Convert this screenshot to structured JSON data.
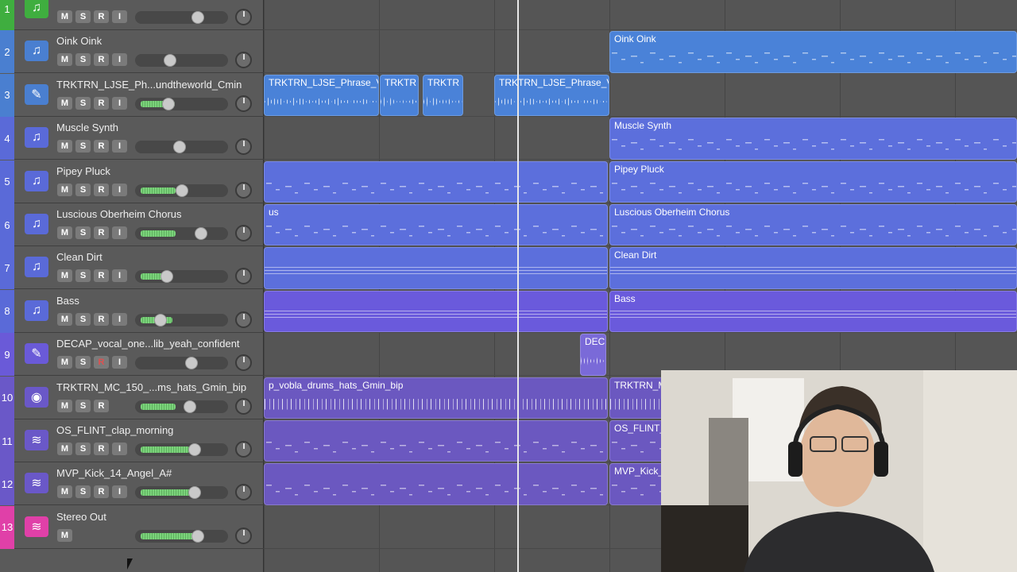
{
  "tracks": [
    {
      "num": "1",
      "name": "",
      "color": "#3fae3f",
      "icon": "note-icon",
      "buttons": [
        "M",
        "S",
        "R",
        "I"
      ],
      "level": 0,
      "knob": 0.7
    },
    {
      "num": "2",
      "name": "Oink Oink",
      "color": "#4a7fd0",
      "icon": "note-icon",
      "buttons": [
        "M",
        "S",
        "R",
        "I"
      ],
      "level": 0,
      "knob": 0.36
    },
    {
      "num": "3",
      "name": "TRKTRN_LJSE_Ph...undtheworld_Cmin",
      "color": "#4a7fd0",
      "icon": "pencil-icon",
      "buttons": [
        "M",
        "S",
        "R",
        "I"
      ],
      "level": 0.43,
      "knob": 0.34
    },
    {
      "num": "4",
      "name": "Muscle Synth",
      "color": "#5a6ad8",
      "icon": "note-icon",
      "buttons": [
        "M",
        "S",
        "R",
        "I"
      ],
      "level": 0,
      "knob": 0.48
    },
    {
      "num": "5",
      "name": "Pipey Pluck",
      "color": "#5a6ad8",
      "icon": "note-icon",
      "buttons": [
        "M",
        "S",
        "R",
        "I"
      ],
      "level": 0.44,
      "knob": 0.5
    },
    {
      "num": "6",
      "name": "Luscious Oberheim Chorus",
      "color": "#5a6ad8",
      "icon": "note-icon",
      "buttons": [
        "M",
        "S",
        "R",
        "I"
      ],
      "level": 0.44,
      "knob": 0.74
    },
    {
      "num": "7",
      "name": "Clean Dirt",
      "color": "#5a6ad8",
      "icon": "note-icon",
      "buttons": [
        "M",
        "S",
        "R",
        "I"
      ],
      "level": 0.32,
      "knob": 0.32
    },
    {
      "num": "8",
      "name": "Bass",
      "color": "#5a6ad8",
      "icon": "note-icon",
      "buttons": [
        "M",
        "S",
        "R",
        "I"
      ],
      "level": 0.4,
      "knob": 0.24
    },
    {
      "num": "9",
      "name": "DECAP_vocal_one...lib_yeah_confident",
      "color": "#6a5ad8",
      "icon": "pencil-icon",
      "buttons": [
        "M",
        "S",
        "R",
        "I"
      ],
      "level": 0,
      "knob": 0.62
    },
    {
      "num": "10",
      "name": "TRKTRN_MC_150_...ms_hats_Gmin_bip",
      "color": "#6a58c8",
      "icon": "drum-icon",
      "buttons": [
        "M",
        "S",
        "R"
      ],
      "level": 0.44,
      "knob": 0.6
    },
    {
      "num": "11",
      "name": "OS_FLINT_clap_morning",
      "color": "#6a58c8",
      "icon": "waveform-icon",
      "buttons": [
        "M",
        "S",
        "R",
        "I"
      ],
      "level": 0.62,
      "knob": 0.66
    },
    {
      "num": "12",
      "name": "MVP_Kick_14_Angel_A#",
      "color": "#6a58c8",
      "icon": "waveform-icon",
      "buttons": [
        "M",
        "S",
        "R",
        "I"
      ],
      "level": 0.74,
      "knob": 0.66
    },
    {
      "num": "13",
      "name": "Stereo Out",
      "color": "#e040a8",
      "icon": "waveform-icon",
      "buttons": [
        "M"
      ],
      "level": 0.74,
      "knob": 0.7
    }
  ],
  "regions": [
    {
      "track": 2,
      "label": "Oink Oink",
      "color": "#4a82d8",
      "kind": "midi"
    },
    {
      "track": 3,
      "label": "TRKTRN_LJSE_Phrase_V",
      "color": "#4a82d8",
      "kind": "audio"
    },
    {
      "track": 3,
      "label": "TRKTR",
      "color": "#4a82d8",
      "kind": "audio"
    },
    {
      "track": 3,
      "label": "TRKTR",
      "color": "#4a82d8",
      "kind": "audio"
    },
    {
      "track": 3,
      "label": "TRKTRN_LJSE_Phrase_V",
      "color": "#4a82d8",
      "kind": "audio"
    },
    {
      "track": 4,
      "label": "Muscle Synth",
      "color": "#5c6fdc",
      "kind": "midi"
    },
    {
      "track": 5,
      "label": "",
      "color": "#5c6fdc",
      "kind": "midi"
    },
    {
      "track": 5,
      "label": "Pipey Pluck",
      "color": "#5c6fdc",
      "kind": "midi"
    },
    {
      "track": 6,
      "label": "us",
      "color": "#5c6fdc",
      "kind": "midi"
    },
    {
      "track": 6,
      "label": "Luscious Oberheim Chorus",
      "color": "#5c6fdc",
      "kind": "midi"
    },
    {
      "track": 7,
      "label": "",
      "color": "#5c6fdc",
      "kind": "lines"
    },
    {
      "track": 7,
      "label": "Clean Dirt",
      "color": "#5c6fdc",
      "kind": "lines"
    },
    {
      "track": 8,
      "label": "",
      "color": "#6a5adc",
      "kind": "lines"
    },
    {
      "track": 8,
      "label": "Bass",
      "color": "#6a5adc",
      "kind": "lines"
    },
    {
      "track": 9,
      "label": "DEC",
      "color": "#7a6ad8",
      "kind": "audio"
    },
    {
      "track": 10,
      "label": "p_vobla_drums_hats_Gmin_bip",
      "color": "#6b58c0",
      "kind": "drums"
    },
    {
      "track": 10,
      "label": "TRKTRN_M",
      "color": "#6b58c0",
      "kind": "drums"
    },
    {
      "track": 11,
      "label": "",
      "color": "#6b58c0",
      "kind": "midi"
    },
    {
      "track": 11,
      "label": "OS_FLINT_",
      "color": "#6b58c0",
      "kind": "midi"
    },
    {
      "track": 12,
      "label": "",
      "color": "#6b58c0",
      "kind": "midi"
    },
    {
      "track": 12,
      "label": "MVP_Kick_",
      "color": "#6b58c0",
      "kind": "midi"
    }
  ]
}
